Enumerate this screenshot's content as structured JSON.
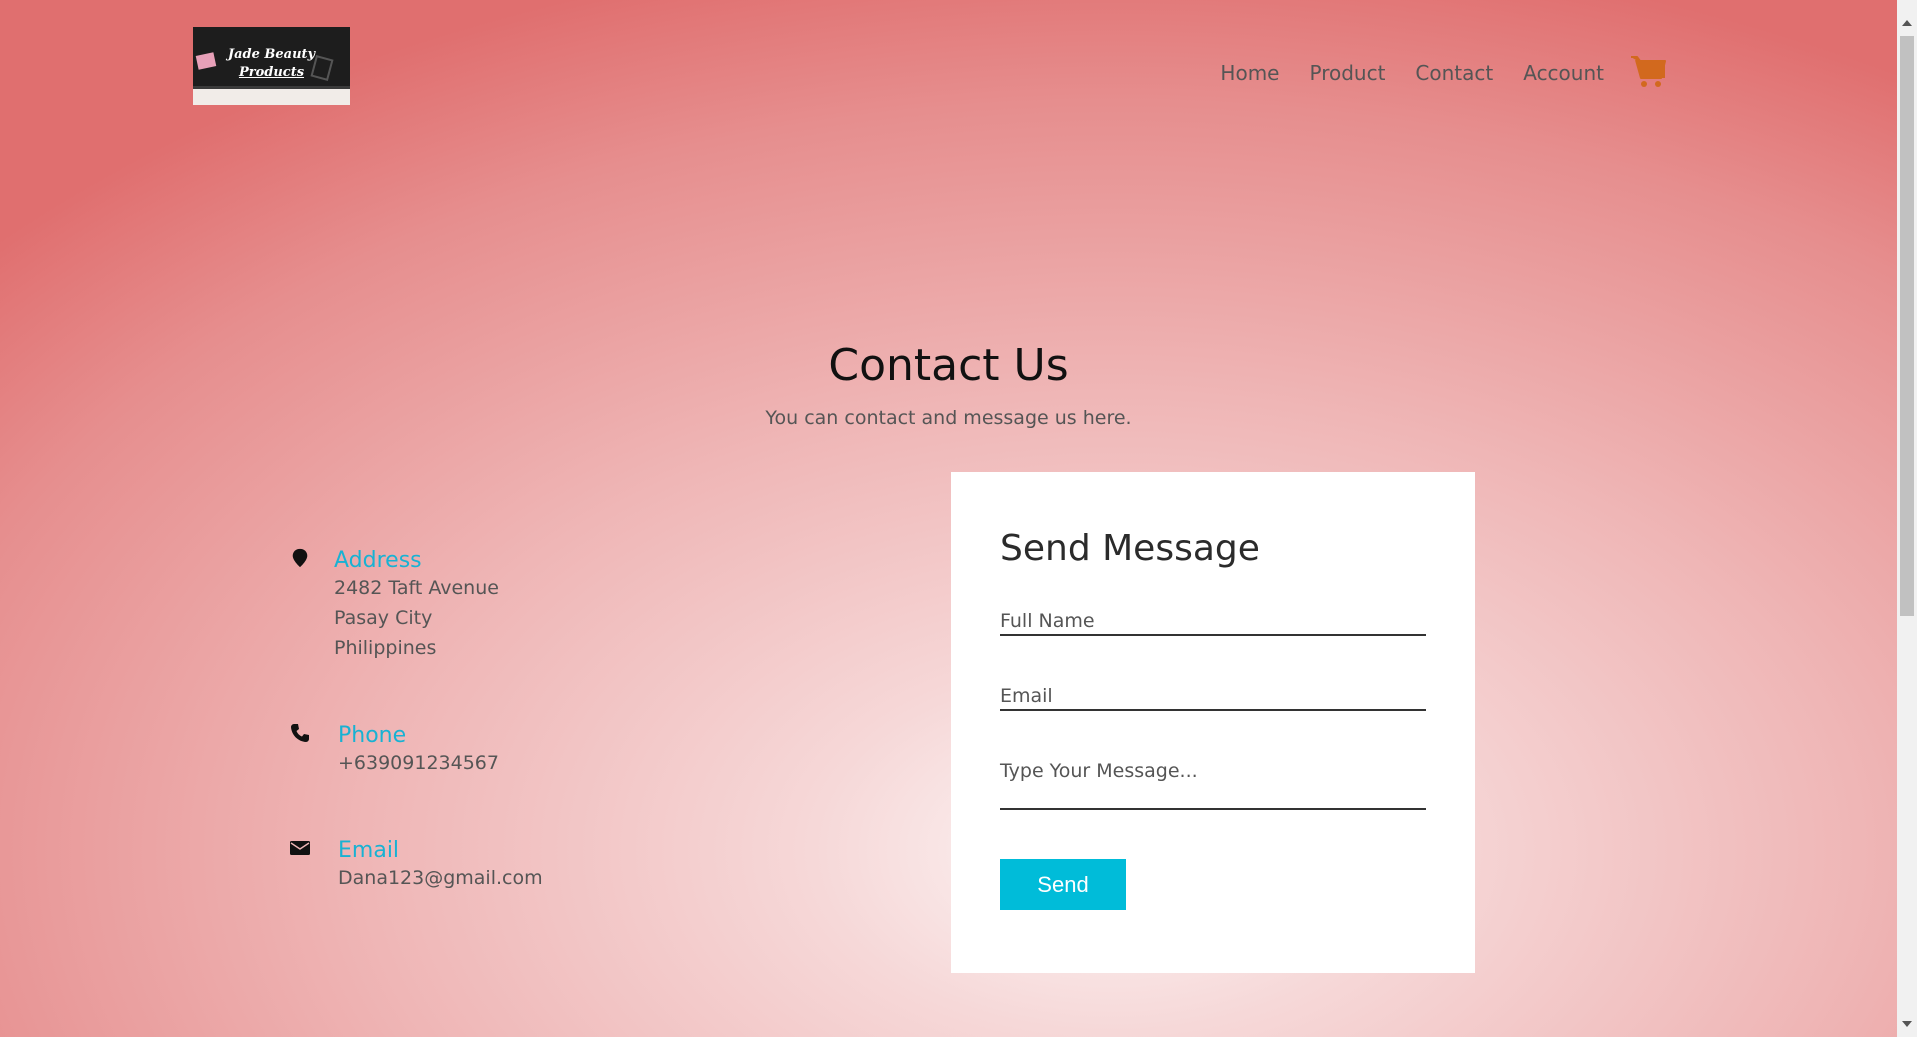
{
  "header": {
    "logo_line1": "Jade Beauty",
    "logo_line2": "Products",
    "nav": [
      "Home",
      "Product",
      "Contact",
      "Account"
    ],
    "cart_icon": "shopping-cart-icon",
    "cart_color": "#d2691e"
  },
  "hero": {
    "title": "Contact Us",
    "subtitle": "You can contact and message us here."
  },
  "contact_info": {
    "address": {
      "icon": "map-pin-icon",
      "label": "Address",
      "lines": [
        "2482 Taft Avenue",
        "Pasay City",
        "Philippines"
      ]
    },
    "phone": {
      "icon": "phone-icon",
      "label": "Phone",
      "value": "+639091234567"
    },
    "email": {
      "icon": "envelope-icon",
      "label": "Email",
      "value": "Dana123@gmail.com"
    },
    "accent_color": "#18b2d3"
  },
  "form": {
    "title": "Send Message",
    "full_name_placeholder": "Full Name",
    "email_placeholder": "Email",
    "message_placeholder": "Type Your Message...",
    "send_label": "Send",
    "button_color": "#00bcd9"
  }
}
